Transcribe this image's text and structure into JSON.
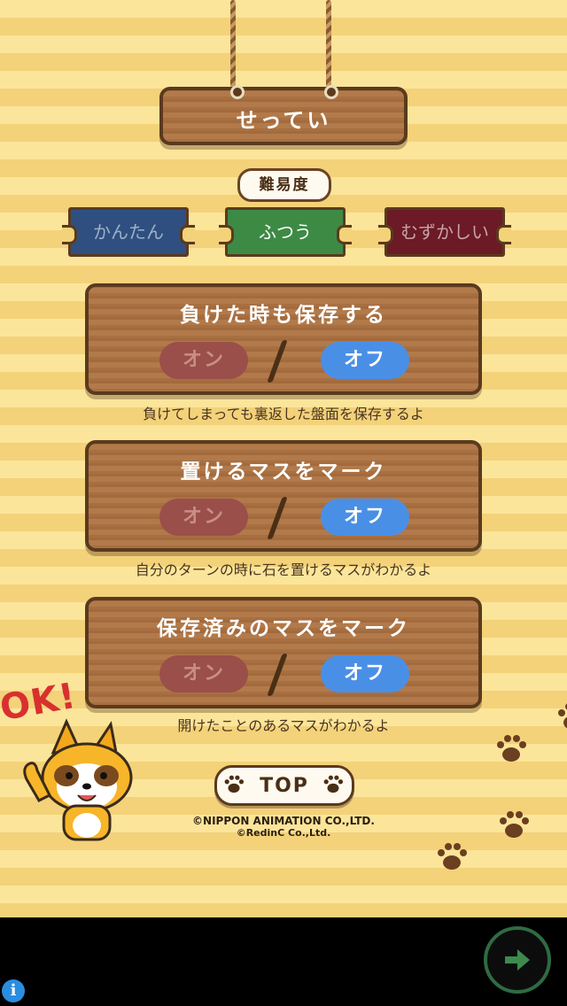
{
  "header": {
    "title": "せってい"
  },
  "difficulty": {
    "label": "難易度",
    "options": [
      "かんたん",
      "ふつう",
      "むずかしい"
    ],
    "selected": "ふつう"
  },
  "settings": [
    {
      "title": "負けた時も保存する",
      "on_label": "オン",
      "off_label": "オフ",
      "selected": "オフ",
      "description": "負けてしまっても裏返した盤面を保存するよ"
    },
    {
      "title": "置けるマスをマーク",
      "on_label": "オン",
      "off_label": "オフ",
      "selected": "オフ",
      "description": "自分のターンの時に石を置けるマスがわかるよ"
    },
    {
      "title": "保存済みのマスをマーク",
      "on_label": "オン",
      "off_label": "オフ",
      "selected": "オフ",
      "description": "開けたことのあるマスがわかるよ"
    }
  ],
  "mascot": {
    "speech": "OK!"
  },
  "top_button": {
    "label": "TOP"
  },
  "copyright": {
    "line1": "©NIPPON ANIMATION CO.,LTD.",
    "line2": "©RedinC Co.,Ltd."
  },
  "ad": {
    "info_icon": "i"
  },
  "colors": {
    "accent_on": "#4a8fe6",
    "wood": "#a86f41",
    "background": "#fbe59a"
  }
}
